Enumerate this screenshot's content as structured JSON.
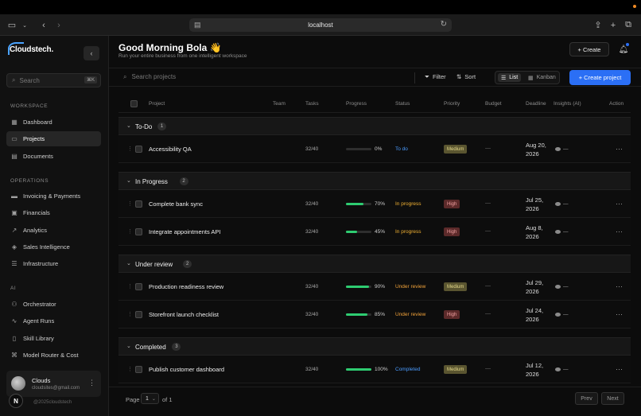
{
  "browser": {
    "url": "localhost",
    "icons": [
      "sidebar-toggle-icon",
      "chevron-down-icon",
      "back-icon",
      "forward-icon",
      "share-icon",
      "new-tab-icon",
      "tabs-icon",
      "reload-icon"
    ]
  },
  "sidebar": {
    "logo": "Cloudstech.",
    "search_placeholder": "Search",
    "search_shortcut": "⌘K",
    "sections": {
      "workspace": "WORKSPACE",
      "operations": "OPERATIONS",
      "ai": "AI"
    },
    "workspace_items": [
      {
        "label": "Dashboard",
        "icon": "grid-icon",
        "glyph": "▦"
      },
      {
        "label": "Projects",
        "icon": "folder-icon",
        "glyph": "▭"
      },
      {
        "label": "Documents",
        "icon": "document-icon",
        "glyph": "▤"
      }
    ],
    "operations_items": [
      {
        "label": "Invoicing & Payments",
        "icon": "invoice-icon",
        "glyph": "▬"
      },
      {
        "label": "Financials",
        "icon": "wallet-icon",
        "glyph": "▣"
      },
      {
        "label": "Analytics",
        "icon": "trend-icon",
        "glyph": "↗"
      },
      {
        "label": "Sales Intelligence",
        "icon": "tag-icon",
        "glyph": "◈"
      },
      {
        "label": "Infrastructure",
        "icon": "server-icon",
        "glyph": "☰"
      }
    ],
    "ai_items": [
      {
        "label": "Orchestrator",
        "icon": "orchestrator-icon",
        "glyph": "⚇"
      },
      {
        "label": "Agent Runs",
        "icon": "activity-icon",
        "glyph": "∿"
      },
      {
        "label": "Skill Library",
        "icon": "book-icon",
        "glyph": "▯"
      },
      {
        "label": "Model Router & Cost",
        "icon": "router-icon",
        "glyph": "⌘"
      }
    ],
    "user": {
      "name": "Clouds",
      "email": "cloudsites@gmail.com"
    },
    "badge": "N",
    "copyright": "@2025cloudstech"
  },
  "header": {
    "greeting": "Good Morning Bola 👋",
    "subtitle": "Run your entire business from one intelligent workspace",
    "create_label": "+ Create"
  },
  "toolbar": {
    "search_placeholder": "Search projects",
    "filter_label": "Filter",
    "sort_label": "Sort",
    "view_list": "List",
    "view_kanban": "Kanban",
    "new_project_label": "+ Create project"
  },
  "table": {
    "columns": [
      "Project",
      "Team",
      "Tasks",
      "Progress",
      "Status",
      "Priority",
      "Budget",
      "Deadline",
      "Insights (AI)",
      "Action"
    ],
    "groups": [
      {
        "name": "To-Do",
        "count": "1",
        "rows": [
          {
            "project": "Accessibility QA",
            "tasks": "32/40",
            "progress": 0,
            "progress_label": "0%",
            "status": "To do",
            "priority": "Medium",
            "budget": "—",
            "deadline_line1": "Aug 20,",
            "deadline_line2": "2026",
            "insight": "—"
          }
        ]
      },
      {
        "name": "In Progress",
        "count": "2",
        "rows": [
          {
            "project": "Complete bank sync",
            "tasks": "32/40",
            "progress": 70,
            "progress_label": "70%",
            "status": "In progress",
            "priority": "High",
            "budget": "—",
            "deadline_line1": "Jul 25,",
            "deadline_line2": "2026",
            "insight": "—"
          },
          {
            "project": "Integrate appointments API",
            "tasks": "32/40",
            "progress": 45,
            "progress_label": "45%",
            "status": "In progress",
            "priority": "High",
            "budget": "—",
            "deadline_line1": "Aug 8,",
            "deadline_line2": "2026",
            "insight": "—"
          }
        ]
      },
      {
        "name": "Under review",
        "count": "2",
        "rows": [
          {
            "project": "Production readiness review",
            "tasks": "32/40",
            "progress": 90,
            "progress_label": "90%",
            "status": "Under review",
            "priority": "Medium",
            "budget": "—",
            "deadline_line1": "Jul 29,",
            "deadline_line2": "2026",
            "insight": "—"
          },
          {
            "project": "Storefront launch checklist",
            "tasks": "32/40",
            "progress": 85,
            "progress_label": "85%",
            "status": "Under review",
            "priority": "High",
            "budget": "—",
            "deadline_line1": "Jul 24,",
            "deadline_line2": "2026",
            "insight": "—"
          }
        ]
      },
      {
        "name": "Completed",
        "count": "3",
        "rows": [
          {
            "project": "Publish customer dashboard",
            "tasks": "32/40",
            "progress": 100,
            "progress_label": "100%",
            "status": "Completed",
            "priority": "Medium",
            "budget": "—",
            "deadline_line1": "Jul 12,",
            "deadline_line2": "2026",
            "insight": "—"
          }
        ]
      }
    ]
  },
  "pagination": {
    "page_label": "Page",
    "page_value": "1",
    "of_label": "of 1",
    "prev": "Prev",
    "next": "Next"
  },
  "colors": {
    "accent": "#2b6ff5",
    "progress": "#2ecc71",
    "status_todo": "#4b9cff",
    "status_in_progress": "#f2b233",
    "status_under_review": "#f2a33a",
    "status_completed": "#4b9cff",
    "priority_medium_bg": "#5a5530",
    "priority_medium_fg": "#e4d98a",
    "priority_high_bg": "#5c2a2a",
    "priority_high_fg": "#f0a0a0"
  }
}
